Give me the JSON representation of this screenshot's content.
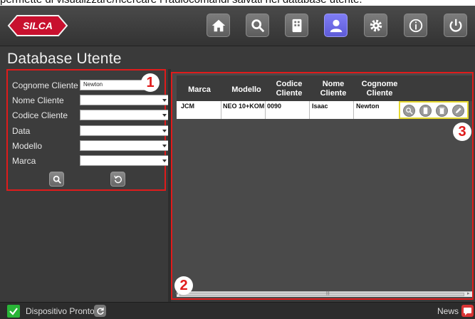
{
  "caption": "permette di visualizzare/ricercare i radiocomandi salvati nel database utente.",
  "brand": {
    "logo_text": "SILCA",
    "accent": "#c8102e"
  },
  "nav": [
    {
      "name": "home-icon"
    },
    {
      "name": "search-icon"
    },
    {
      "name": "remote-icon"
    },
    {
      "name": "user-icon",
      "active": true
    },
    {
      "name": "gear-icon"
    },
    {
      "name": "info-icon"
    },
    {
      "name": "power-icon"
    }
  ],
  "page": {
    "title": "Database Utente"
  },
  "filters": {
    "fields": [
      {
        "label": "Cognome Cliente",
        "value": "Newton"
      },
      {
        "label": "Nome Cliente",
        "value": ""
      },
      {
        "label": "Codice Cliente",
        "value": ""
      },
      {
        "label": "Data",
        "value": ""
      },
      {
        "label": "Modello",
        "value": ""
      },
      {
        "label": "Marca",
        "value": ""
      }
    ],
    "search_icon": "search-icon",
    "reset_icon": "reset-icon"
  },
  "results": {
    "columns": [
      "Marca",
      "Modello",
      "Codice Cliente",
      "Nome Cliente",
      "Cognome Cliente"
    ],
    "rows": [
      {
        "marca": "JCM",
        "modello": "NEO 10+KOM",
        "codice": "0090",
        "nome": "Isaac",
        "cognome": "Newton"
      }
    ],
    "actions": [
      "zoom-icon",
      "remote-icon",
      "trash-icon",
      "pencil-icon"
    ]
  },
  "callouts": [
    "1",
    "2",
    "3"
  ],
  "status": {
    "text": "Dispositivo Pronto",
    "news": "News"
  }
}
